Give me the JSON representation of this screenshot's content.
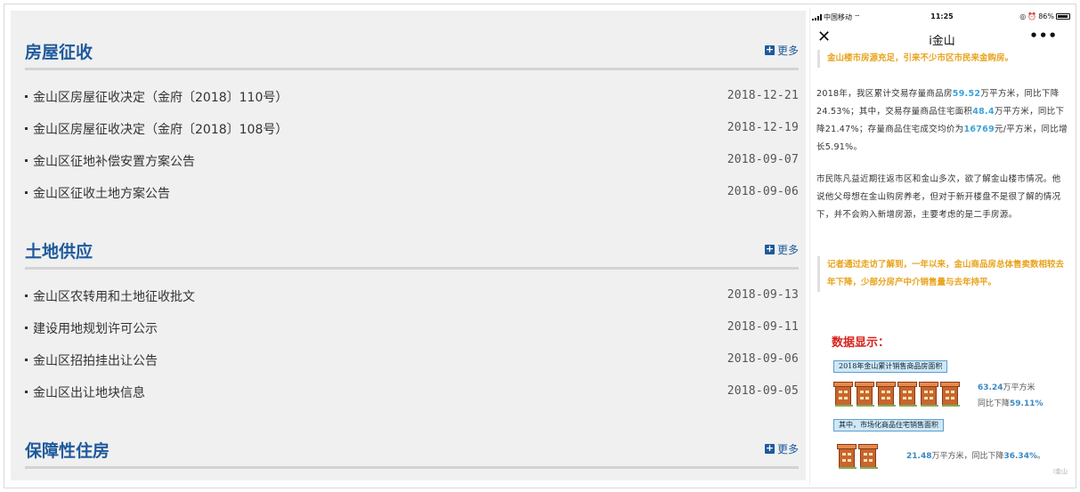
{
  "sections": [
    {
      "title": "房屋征收",
      "more": "更多",
      "items": [
        {
          "text": "金山区房屋征收决定（金府〔2018〕110号）",
          "date": "2018-12-21"
        },
        {
          "text": "金山区房屋征收决定（金府〔2018〕108号）",
          "date": "2018-12-19"
        },
        {
          "text": "金山区征地补偿安置方案公告",
          "date": "2018-09-07"
        },
        {
          "text": "金山区征收土地方案公告",
          "date": "2018-09-06"
        }
      ]
    },
    {
      "title": "土地供应",
      "more": "更多",
      "items": [
        {
          "text": "金山区农转用和土地征收批文",
          "date": "2018-09-13"
        },
        {
          "text": "建设用地规划许可公示",
          "date": "2018-09-11"
        },
        {
          "text": "金山区招拍挂出让公告",
          "date": "2018-09-06"
        },
        {
          "text": "金山区出让地块信息",
          "date": "2018-09-05"
        }
      ]
    },
    {
      "title": "保障性住房",
      "more": "更多",
      "items": []
    }
  ],
  "phone": {
    "status": {
      "carrier": "中国移动",
      "time": "11:25",
      "battery": "86%"
    },
    "nav_title": "i金山",
    "quote1": "金山楼市房源充足，引来不少市区市民来金购房。",
    "para1": {
      "t1": "2018年，我区累计交易存量商品房",
      "v1": "59.52",
      "t2": "万平方米，同比下降24.53%；其中，交易存量商品住宅面积",
      "v2": "48.4",
      "t3": "万平方米，同比下降21.47%；存量商品住宅成交均价为",
      "v3": "16769",
      "t4": "元/平方米，同比增长5.91%。"
    },
    "para2": "市民陈凡益近期往返市区和金山多次，欲了解金山楼市情况。他说他父母想在金山购房养老，但对于新开楼盘不是很了解的情况下，并不会购入新增房源，主要考虑的是二手房源。",
    "quote2": "记者通过走访了解到，一年以来，金山商品房总体售卖数相较去年下降，少部分房产中介销售量与去年持平。",
    "data_title": "数据显示：",
    "tag1": "2018年金山累计销售商品房面积",
    "stat1": {
      "value": "63.24",
      "unit": "万平方米",
      "pre": "同比下降",
      "pct": "59.11%"
    },
    "tag2": "其中，市场化商品住宅销售面积",
    "stat2": {
      "value": "21.48",
      "unit": "万平方米，同比下降",
      "pct": "36.34%",
      "tail": "。"
    },
    "watermark": "i金山"
  }
}
